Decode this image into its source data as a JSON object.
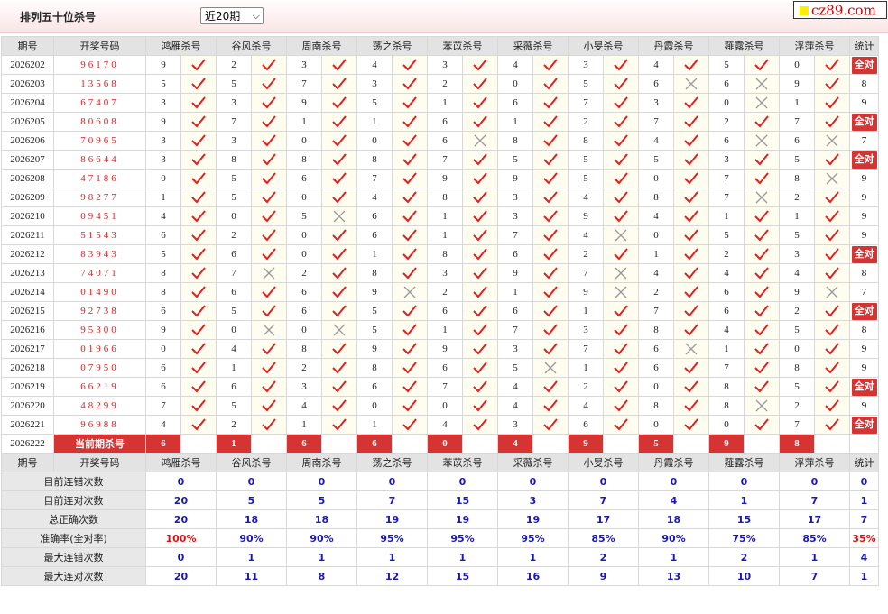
{
  "header": {
    "title": "排列五十位杀号",
    "period_select": "近20期",
    "logo": "cz89.com"
  },
  "columns": [
    "期号",
    "开奖号码",
    "鸿雁杀号",
    "谷风杀号",
    "周南杀号",
    "荡之杀号",
    "苯苡杀号",
    "采薇杀号",
    "小旻杀号",
    "丹霞杀号",
    "薤露杀号",
    "浮萍杀号",
    "统计"
  ],
  "experts": [
    "鸿雁杀号",
    "谷风杀号",
    "周南杀号",
    "荡之杀号",
    "苯苡杀号",
    "采薇杀号",
    "小旻杀号",
    "丹霞杀号",
    "薤露杀号",
    "浮萍杀号"
  ],
  "rows": [
    {
      "period": "2026202",
      "draw": "96170",
      "kills": [
        9,
        2,
        3,
        4,
        3,
        4,
        3,
        4,
        5,
        0
      ],
      "ok": [
        1,
        1,
        1,
        1,
        1,
        1,
        1,
        1,
        1,
        1
      ],
      "stat": "全对"
    },
    {
      "period": "2026203",
      "draw": "13568",
      "kills": [
        5,
        5,
        7,
        3,
        2,
        0,
        5,
        6,
        6,
        9
      ],
      "ok": [
        1,
        1,
        1,
        1,
        1,
        1,
        1,
        0,
        0,
        1
      ],
      "stat": "8"
    },
    {
      "period": "2026204",
      "draw": "67407",
      "kills": [
        3,
        3,
        9,
        5,
        1,
        6,
        7,
        3,
        0,
        1
      ],
      "ok": [
        1,
        1,
        1,
        1,
        1,
        1,
        1,
        1,
        0,
        1
      ],
      "stat": "9"
    },
    {
      "period": "2026205",
      "draw": "80608",
      "kills": [
        9,
        7,
        1,
        1,
        6,
        1,
        2,
        7,
        2,
        7
      ],
      "ok": [
        1,
        1,
        1,
        1,
        1,
        1,
        1,
        1,
        1,
        1
      ],
      "stat": "全对"
    },
    {
      "period": "2026206",
      "draw": "70965",
      "kills": [
        3,
        3,
        0,
        0,
        6,
        8,
        8,
        4,
        6,
        6
      ],
      "ok": [
        1,
        1,
        1,
        1,
        0,
        1,
        1,
        1,
        0,
        0
      ],
      "stat": "7"
    },
    {
      "period": "2026207",
      "draw": "86644",
      "kills": [
        3,
        8,
        8,
        8,
        7,
        5,
        5,
        5,
        3,
        5
      ],
      "ok": [
        1,
        1,
        1,
        1,
        1,
        1,
        1,
        1,
        1,
        1
      ],
      "stat": "全对"
    },
    {
      "period": "2026208",
      "draw": "47186",
      "kills": [
        0,
        5,
        6,
        7,
        9,
        9,
        5,
        0,
        7,
        8
      ],
      "ok": [
        1,
        1,
        1,
        1,
        1,
        1,
        1,
        1,
        1,
        0
      ],
      "stat": "9"
    },
    {
      "period": "2026209",
      "draw": "98277",
      "kills": [
        1,
        5,
        0,
        4,
        8,
        3,
        4,
        8,
        7,
        2
      ],
      "ok": [
        1,
        1,
        1,
        1,
        1,
        1,
        1,
        1,
        0,
        1
      ],
      "stat": "9"
    },
    {
      "period": "2026210",
      "draw": "09451",
      "kills": [
        4,
        0,
        5,
        6,
        1,
        3,
        9,
        4,
        1,
        1
      ],
      "ok": [
        1,
        1,
        0,
        1,
        1,
        1,
        1,
        1,
        1,
        1
      ],
      "stat": "9"
    },
    {
      "period": "2026211",
      "draw": "51543",
      "kills": [
        6,
        2,
        0,
        6,
        1,
        7,
        4,
        0,
        5,
        5
      ],
      "ok": [
        1,
        1,
        1,
        1,
        1,
        1,
        0,
        1,
        1,
        1
      ],
      "stat": "9"
    },
    {
      "period": "2026212",
      "draw": "83943",
      "kills": [
        5,
        6,
        0,
        1,
        8,
        6,
        2,
        1,
        2,
        3
      ],
      "ok": [
        1,
        1,
        1,
        1,
        1,
        1,
        1,
        1,
        1,
        1
      ],
      "stat": "全对"
    },
    {
      "period": "2026213",
      "draw": "74071",
      "kills": [
        8,
        7,
        2,
        8,
        3,
        9,
        7,
        4,
        4,
        4
      ],
      "ok": [
        1,
        0,
        1,
        1,
        1,
        1,
        0,
        1,
        1,
        1
      ],
      "stat": "8"
    },
    {
      "period": "2026214",
      "draw": "01490",
      "kills": [
        8,
        6,
        6,
        9,
        2,
        1,
        9,
        2,
        6,
        9
      ],
      "ok": [
        1,
        1,
        1,
        0,
        1,
        1,
        0,
        1,
        1,
        0
      ],
      "stat": "7"
    },
    {
      "period": "2026215",
      "draw": "92738",
      "kills": [
        6,
        5,
        6,
        5,
        6,
        6,
        1,
        7,
        6,
        2
      ],
      "ok": [
        1,
        1,
        1,
        1,
        1,
        1,
        1,
        1,
        1,
        1
      ],
      "stat": "全对"
    },
    {
      "period": "2026216",
      "draw": "95300",
      "kills": [
        9,
        0,
        0,
        5,
        1,
        7,
        3,
        8,
        4,
        5
      ],
      "ok": [
        1,
        0,
        0,
        1,
        1,
        1,
        1,
        1,
        1,
        1
      ],
      "stat": "8"
    },
    {
      "period": "2026217",
      "draw": "01966",
      "kills": [
        0,
        4,
        8,
        9,
        9,
        3,
        7,
        6,
        1,
        0
      ],
      "ok": [
        1,
        1,
        1,
        1,
        1,
        1,
        1,
        0,
        1,
        1
      ],
      "stat": "9"
    },
    {
      "period": "2026218",
      "draw": "07950",
      "kills": [
        6,
        1,
        2,
        8,
        6,
        5,
        1,
        6,
        7,
        8
      ],
      "ok": [
        1,
        1,
        1,
        1,
        1,
        0,
        1,
        1,
        1,
        1
      ],
      "stat": "9"
    },
    {
      "period": "2026219",
      "draw": "66219",
      "kills": [
        6,
        6,
        3,
        6,
        7,
        4,
        2,
        0,
        8,
        5
      ],
      "ok": [
        1,
        1,
        1,
        1,
        1,
        1,
        1,
        1,
        1,
        1
      ],
      "stat": "全对"
    },
    {
      "period": "2026220",
      "draw": "48299",
      "kills": [
        7,
        5,
        4,
        0,
        0,
        4,
        4,
        8,
        8,
        2
      ],
      "ok": [
        1,
        1,
        1,
        1,
        1,
        1,
        1,
        1,
        0,
        1
      ],
      "stat": "9"
    },
    {
      "period": "2026221",
      "draw": "96988",
      "kills": [
        4,
        2,
        1,
        1,
        4,
        3,
        6,
        0,
        0,
        7
      ],
      "ok": [
        1,
        1,
        1,
        1,
        1,
        1,
        1,
        1,
        1,
        1
      ],
      "stat": "全对"
    }
  ],
  "current": {
    "period": "2026222",
    "label": "当前期杀号",
    "kills": [
      "6",
      "1",
      "6",
      "6",
      "0",
      "4",
      "9",
      "5",
      "9",
      "8"
    ]
  },
  "summary": [
    {
      "label": "目前连错次数",
      "values": [
        "0",
        "0",
        "0",
        "0",
        "0",
        "0",
        "0",
        "0",
        "0",
        "0"
      ],
      "total": "0"
    },
    {
      "label": "目前连对次数",
      "values": [
        "20",
        "5",
        "5",
        "7",
        "15",
        "3",
        "7",
        "4",
        "1",
        "7"
      ],
      "total": "1"
    },
    {
      "label": "总正确次数",
      "values": [
        "20",
        "18",
        "18",
        "19",
        "19",
        "19",
        "17",
        "18",
        "15",
        "17"
      ],
      "total": "7"
    },
    {
      "label": "准确率(全对率)",
      "values": [
        "100%",
        "90%",
        "90%",
        "95%",
        "95%",
        "95%",
        "85%",
        "90%",
        "75%",
        "85%"
      ],
      "total": "35%"
    },
    {
      "label": "最大连错次数",
      "values": [
        "0",
        "1",
        "1",
        "1",
        "1",
        "1",
        "2",
        "1",
        "2",
        "1"
      ],
      "total": "4"
    },
    {
      "label": "最大连对次数",
      "values": [
        "20",
        "11",
        "8",
        "12",
        "15",
        "16",
        "9",
        "13",
        "10",
        "7"
      ],
      "total": "1"
    }
  ],
  "colors": {
    "accent": "#d63333",
    "check": "#e02020",
    "cross": "#888888",
    "summary_value": "#1a1ab3"
  }
}
